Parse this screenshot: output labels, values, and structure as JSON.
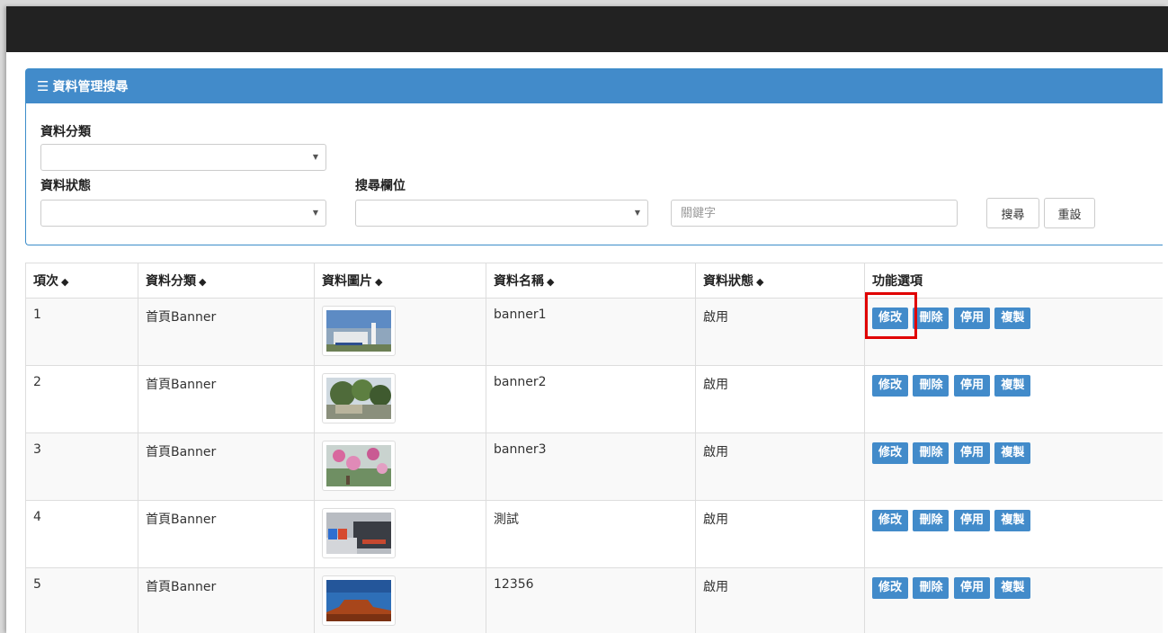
{
  "panel": {
    "title": "資料管理搜尋"
  },
  "search": {
    "category_label": "資料分類",
    "status_label": "資料狀態",
    "field_label": "搜尋欄位",
    "keyword_placeholder": "關鍵字",
    "search_button": "搜尋",
    "reset_button": "重設"
  },
  "table": {
    "headers": [
      "項次",
      "資料分類",
      "資料圖片",
      "資料名稱",
      "資料狀態",
      "功能選項"
    ],
    "actions": [
      "修改",
      "刪除",
      "停用",
      "複製"
    ],
    "rows": [
      {
        "index": "1",
        "category": "首頁Banner",
        "name": "banner1",
        "status": "啟用",
        "image": "campus-building-thumbnail"
      },
      {
        "index": "2",
        "category": "首頁Banner",
        "name": "banner2",
        "status": "啟用",
        "image": "campus-garden-thumbnail"
      },
      {
        "index": "3",
        "category": "首頁Banner",
        "name": "banner3",
        "status": "啟用",
        "image": "flower-blossom-thumbnail"
      },
      {
        "index": "4",
        "category": "首頁Banner",
        "name": "測試",
        "status": "啟用",
        "image": "seo-text-thumbnail"
      },
      {
        "index": "5",
        "category": "首頁Banner",
        "name": "12356",
        "status": "啟用",
        "image": "desert-rock-thumbnail"
      }
    ]
  },
  "colors": {
    "navbar": "#222222",
    "primary": "#428bca",
    "highlight": "#e00000"
  }
}
